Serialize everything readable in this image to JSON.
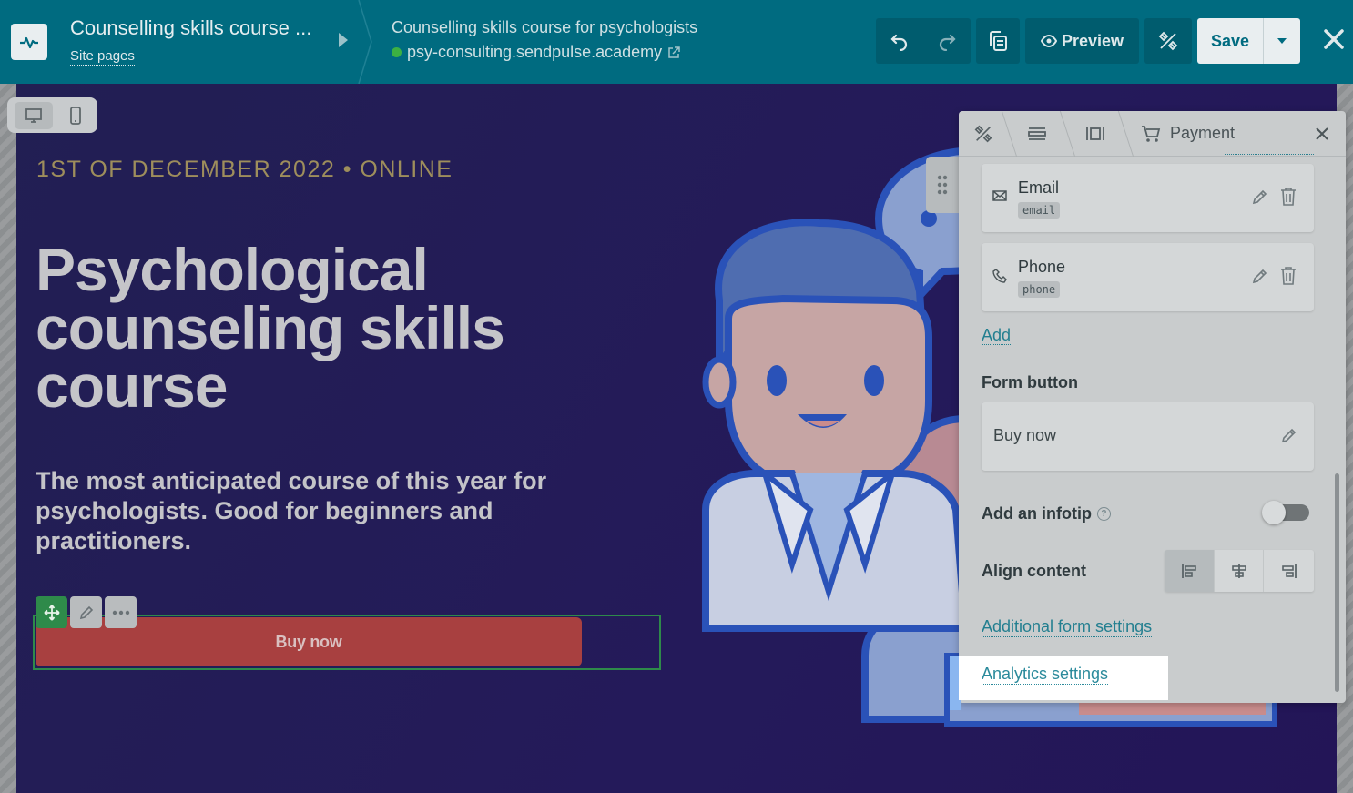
{
  "topbar": {
    "site_title": "Counselling skills course ...",
    "site_pages_link": "Site pages",
    "course_title": "Counselling skills course for psychologists",
    "domain": "psy-consulting.sendpulse.academy",
    "preview_label": "Preview",
    "save_label": "Save",
    "icons": [
      "pulse-logo-icon",
      "undo-icon",
      "redo-icon",
      "layers-icon",
      "eye-icon",
      "design-tools-icon",
      "chevron-down-icon",
      "close-icon",
      "external-link-icon"
    ]
  },
  "canvas": {
    "event_date": "1ST OF DECEMBER 2022 • ONLINE",
    "hero_title": "Psychological counseling skills course",
    "hero_subtitle": "The most anticipated course of this year for psychologists. Good for beginners and practitioners.",
    "cta_label": "Buy now",
    "device_modes": [
      "desktop-icon",
      "mobile-icon"
    ],
    "colors": {
      "background": "#221f53",
      "cta": "#a84040",
      "date": "#9e8e5c",
      "selection": "#2e8a4a"
    }
  },
  "panel": {
    "title": "Payment",
    "fields": [
      {
        "label": "Email",
        "tag": "email",
        "icon": "envelope-icon"
      },
      {
        "label": "Phone",
        "tag": "phone",
        "icon": "phone-icon"
      }
    ],
    "add_link": "Add",
    "form_button_label": "Form button",
    "form_button_text": "Buy now",
    "infotip_label": "Add an infotip",
    "infotip_enabled": false,
    "align_label": "Align content",
    "align_selected": "left",
    "additional_settings_link": "Additional form settings",
    "analytics_link": "Analytics settings"
  }
}
